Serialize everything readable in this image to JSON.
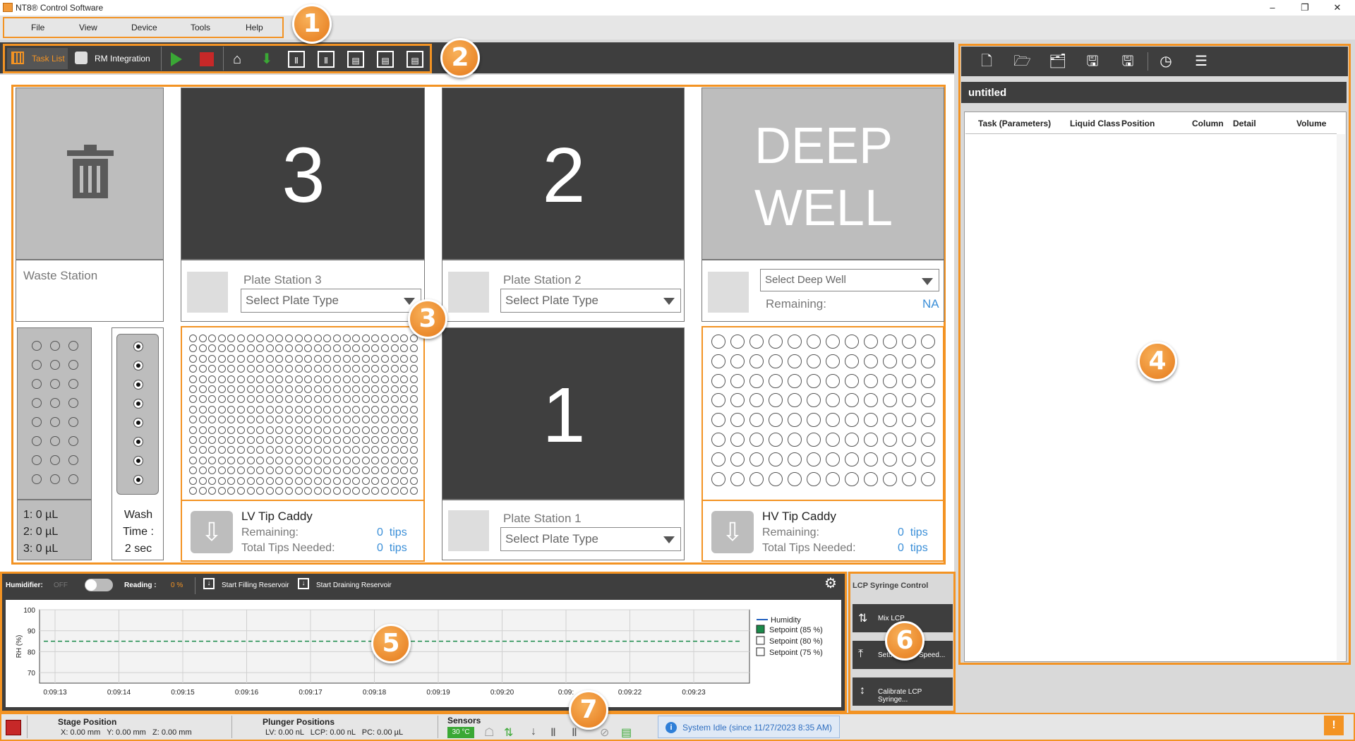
{
  "window": {
    "title": "NT8® Control Software"
  },
  "menu": [
    "File",
    "View",
    "Device",
    "Tools",
    "Help"
  ],
  "toolbar": {
    "task_list": "Task List",
    "rm_integration": "RM Integration"
  },
  "badges": [
    "1",
    "2",
    "3",
    "4",
    "5",
    "6",
    "7"
  ],
  "deck": {
    "waste_station": "Waste Station",
    "plate3": {
      "number": "3",
      "label": "Plate Station 3",
      "select": "Select Plate Type"
    },
    "plate2": {
      "number": "2",
      "label": "Plate Station 2",
      "select": "Select Plate Type"
    },
    "plate1": {
      "number": "1",
      "label": "Plate Station 1",
      "select": "Select Plate Type"
    },
    "deepwell": {
      "title_line1": "DEEP",
      "title_line2": "WELL",
      "select": "Select Deep Well",
      "remaining_label": "Remaining:",
      "remaining_value": "NA"
    },
    "reagents": {
      "r1": "1: 0 µL",
      "r2": "2: 0 µL",
      "r3": "3: 0 µL"
    },
    "wash": {
      "line1": "Wash",
      "line2": "Time :",
      "line3": "2 sec"
    },
    "lv_caddy": {
      "title": "LV Tip Caddy",
      "remaining_label": "Remaining:",
      "remaining_value": "0  tips",
      "needed_label": "Total Tips Needed:",
      "needed_value": "0  tips"
    },
    "hv_caddy": {
      "title": "HV Tip Caddy",
      "remaining_label": "Remaining:",
      "remaining_value": "0  tips",
      "needed_label": "Total Tips Needed:",
      "needed_value": "0  tips"
    }
  },
  "task_panel": {
    "filename": "untitled",
    "columns": [
      "Task (Parameters)",
      "Liquid Class",
      "Position",
      "Column",
      "Detail",
      "Volume"
    ]
  },
  "humidifier": {
    "label": "Humidifier:",
    "state": "OFF",
    "reading_label": "Reading :",
    "reading_value": "0 %",
    "start_filling": "Start Filling Reservoir",
    "start_draining": "Start Draining Reservoir"
  },
  "chart_data": {
    "type": "line",
    "ylabel": "RH (%)",
    "ylim": [
      65,
      100
    ],
    "yticks": [
      "100",
      "90",
      "80",
      "70"
    ],
    "x": [
      "0:09:13",
      "0:09:14",
      "0:09:15",
      "0:09:16",
      "0:09:17",
      "0:09:18",
      "0:09:19",
      "0:09:20",
      "0:09:21",
      "0:09:22",
      "0:09:23"
    ],
    "x_tick_labels": [
      "0:09:13",
      "0:09:14",
      "0:09:15",
      "0:09:16",
      "0:09:17",
      "0:09:18",
      "0:09:19",
      "0:09:20",
      "0:09:",
      "0:09:22",
      "0:09:23"
    ],
    "series": [
      {
        "name": "Humidity",
        "values": [],
        "color": "#1f5fbf"
      },
      {
        "name": "Setpoint (85 %)",
        "values": [
          85,
          85,
          85,
          85,
          85,
          85,
          85,
          85,
          85,
          85,
          85
        ],
        "color": "#1a8a4a",
        "checked": true,
        "dashed": true
      },
      {
        "name": "Setpoint (80 %)",
        "values": [],
        "checked": false
      },
      {
        "name": "Setpoint (75 %)",
        "values": [],
        "checked": false
      }
    ],
    "grid": true,
    "legend_position": "right"
  },
  "lcp": {
    "title": "LCP Syringe Control",
    "mix": "Mix LCP",
    "speed": "Set LCP Speed...",
    "speed_visible_a": "Setu",
    "speed_visible_b": "Speed...",
    "calibrate": "Calibrate LCP Syringe..."
  },
  "status": {
    "stage_title": "Stage Position",
    "stage_values": "X: 0.00 mm   Y: 0.00 mm   Z: 0.00 mm",
    "plunger_title": "Plunger Positions",
    "plunger_values": "LV: 0.00 nL   LCP: 0.00 nL   PC: 0.00 µL",
    "sensors_title": "Sensors",
    "sensor_temp": "30 °C",
    "message": "System Idle (since 11/27/2023 8:35 AM)"
  },
  "colors": {
    "accent": "#f39323",
    "dark": "#3e3e3e",
    "link": "#3b8fd8",
    "green": "#3aa835",
    "red": "#c62828"
  }
}
